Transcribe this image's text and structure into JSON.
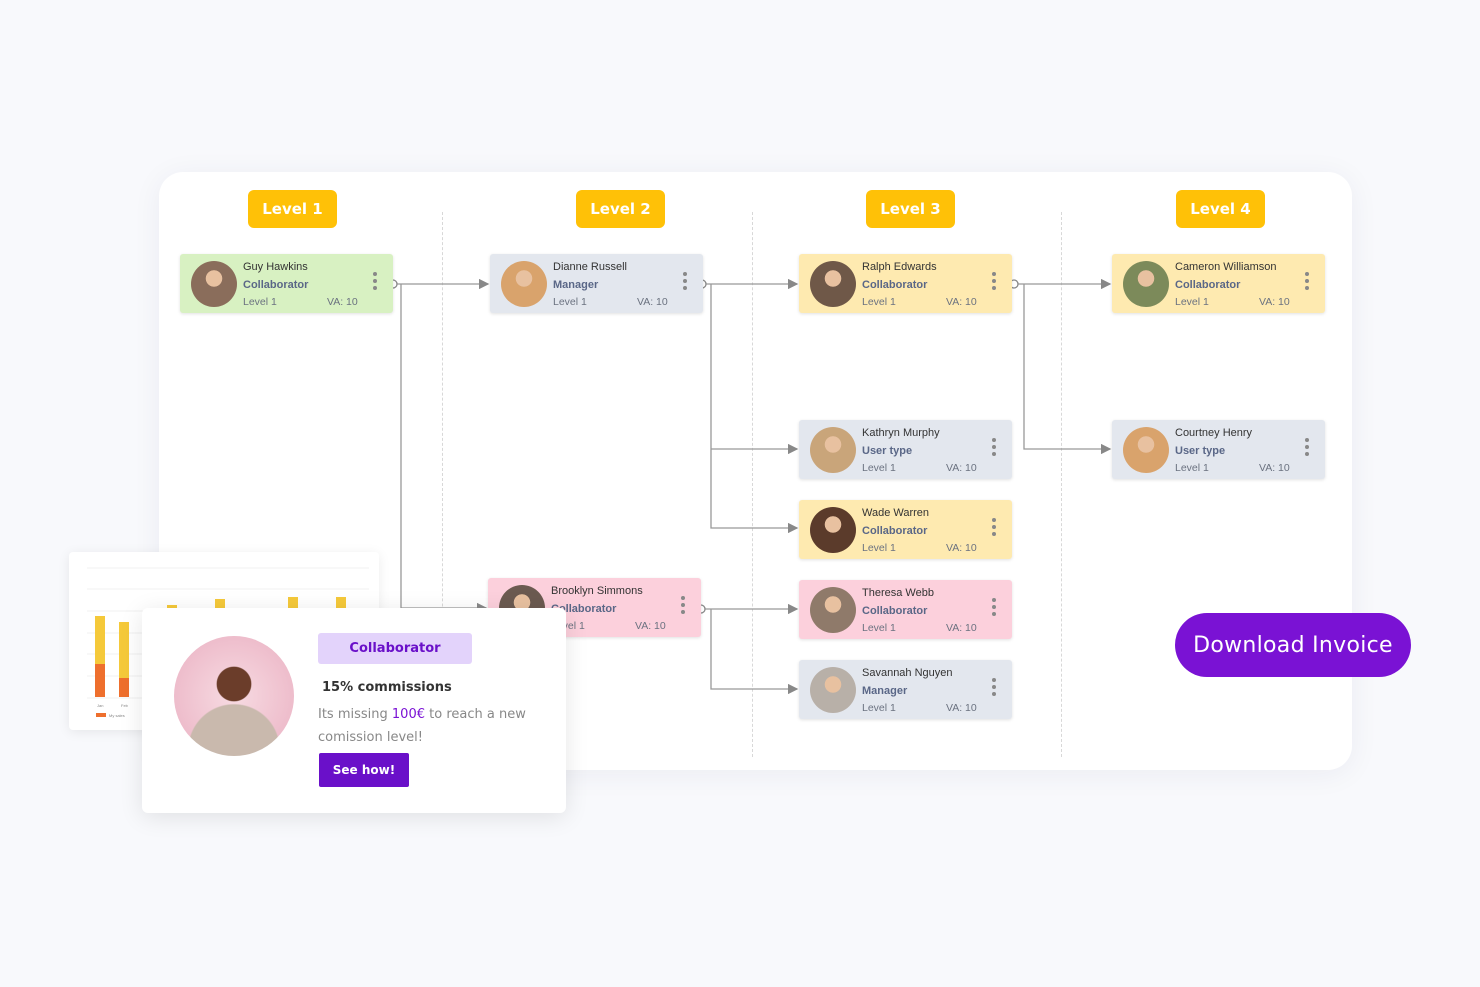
{
  "levels": [
    "Level 1",
    "Level 2",
    "Level 3",
    "Level 4"
  ],
  "cards": [
    {
      "name": "Guy Hawkins",
      "role": "Collaborator",
      "level": "Level 1",
      "va": "VA: 10",
      "color": "#d8f1c2"
    },
    {
      "name": "Dianne Russell",
      "role": "Manager",
      "level": "Level 1",
      "va": "VA: 10",
      "color": "#e3e7ee"
    },
    {
      "name": "Brooklyn Simmons",
      "role": "Collaborator",
      "level": "Level 1",
      "va": "VA: 10",
      "color": "#fcd0dc"
    },
    {
      "name": "Ralph Edwards",
      "role": "Collaborator",
      "level": "Level 1",
      "va": "VA: 10",
      "color": "#feeab0"
    },
    {
      "name": "Kathryn Murphy",
      "role": "User type",
      "level": "Level 1",
      "va": "VA: 10",
      "color": "#e3e7ee"
    },
    {
      "name": "Wade Warren",
      "role": "Collaborator",
      "level": "Level 1",
      "va": "VA: 10",
      "color": "#feeab0"
    },
    {
      "name": "Theresa Webb",
      "role": "Collaborator",
      "level": "Level 1",
      "va": "VA: 10",
      "color": "#fcd0dc"
    },
    {
      "name": "Savannah Nguyen",
      "role": "Manager",
      "level": "Level 1",
      "va": "VA: 10",
      "color": "#e3e7ee"
    },
    {
      "name": "Cameron Williamson",
      "role": "Collaborator",
      "level": "Level 1",
      "va": "VA: 10",
      "color": "#feeab0"
    },
    {
      "name": "Courtney Henry",
      "role": "User type",
      "level": "Level 1",
      "va": "VA: 10",
      "color": "#e3e7ee"
    }
  ],
  "download_label": "Download Invoice",
  "promo": {
    "tag": "Collaborator",
    "commission": "15% commissions",
    "msg_pre": "Its missing ",
    "amount": "100€",
    "msg_post": " to reach a new comission level!",
    "button": "See how!"
  },
  "mini_chart": {
    "legend": "My sales",
    "x_ticks": [
      "Jan",
      "Feb"
    ]
  },
  "colors": {
    "accent": "#7a12d4",
    "level_badge": "#ffc107"
  }
}
